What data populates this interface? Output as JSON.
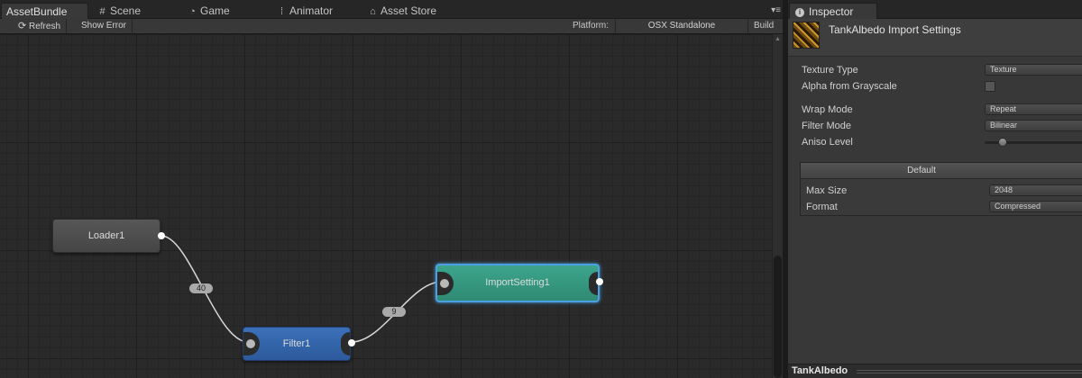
{
  "editor": {
    "tabs": [
      {
        "label": "AssetBundle",
        "icon": "",
        "active": true
      },
      {
        "label": "Scene",
        "icon": "grid-icon"
      },
      {
        "label": "Game",
        "icon": "pacman-icon"
      },
      {
        "label": "Animator",
        "icon": "animator-icon"
      },
      {
        "label": "Asset Store",
        "icon": "bag-icon"
      }
    ],
    "tab_menu": "▾≡",
    "toolbar": {
      "refresh": "Refresh",
      "show_error": "Show Error",
      "platform_label": "Platform:",
      "platform_value": "OSX Standalone",
      "build": "Build"
    },
    "graph": {
      "nodes": {
        "loader": "Loader1",
        "filter": "Filter1",
        "import": "ImportSetting1"
      },
      "edges": {
        "loader_to_filter": "40",
        "filter_to_import": "9"
      }
    }
  },
  "inspector": {
    "tab": "Inspector",
    "title": "TankAlbedo Import Settings",
    "rows": {
      "texture_type": {
        "label": "Texture Type",
        "value": "Texture"
      },
      "alpha_gray": {
        "label": "Alpha from Grayscale",
        "checked": false
      },
      "wrap_mode": {
        "label": "Wrap Mode",
        "value": "Repeat"
      },
      "filter_mode": {
        "label": "Filter Mode",
        "value": "Bilinear"
      },
      "aniso_level": {
        "label": "Aniso Level"
      }
    },
    "platform": {
      "header": "Default",
      "max_size": {
        "label": "Max Size",
        "value": "2048"
      },
      "format": {
        "label": "Format",
        "value": "Compressed"
      }
    },
    "footer": "TankAlbedo"
  },
  "colors": {
    "loader_node": "#4d4d4d",
    "filter_node": "#3465aa",
    "import_node": "#37987f",
    "selection": "#4c9fe0"
  }
}
